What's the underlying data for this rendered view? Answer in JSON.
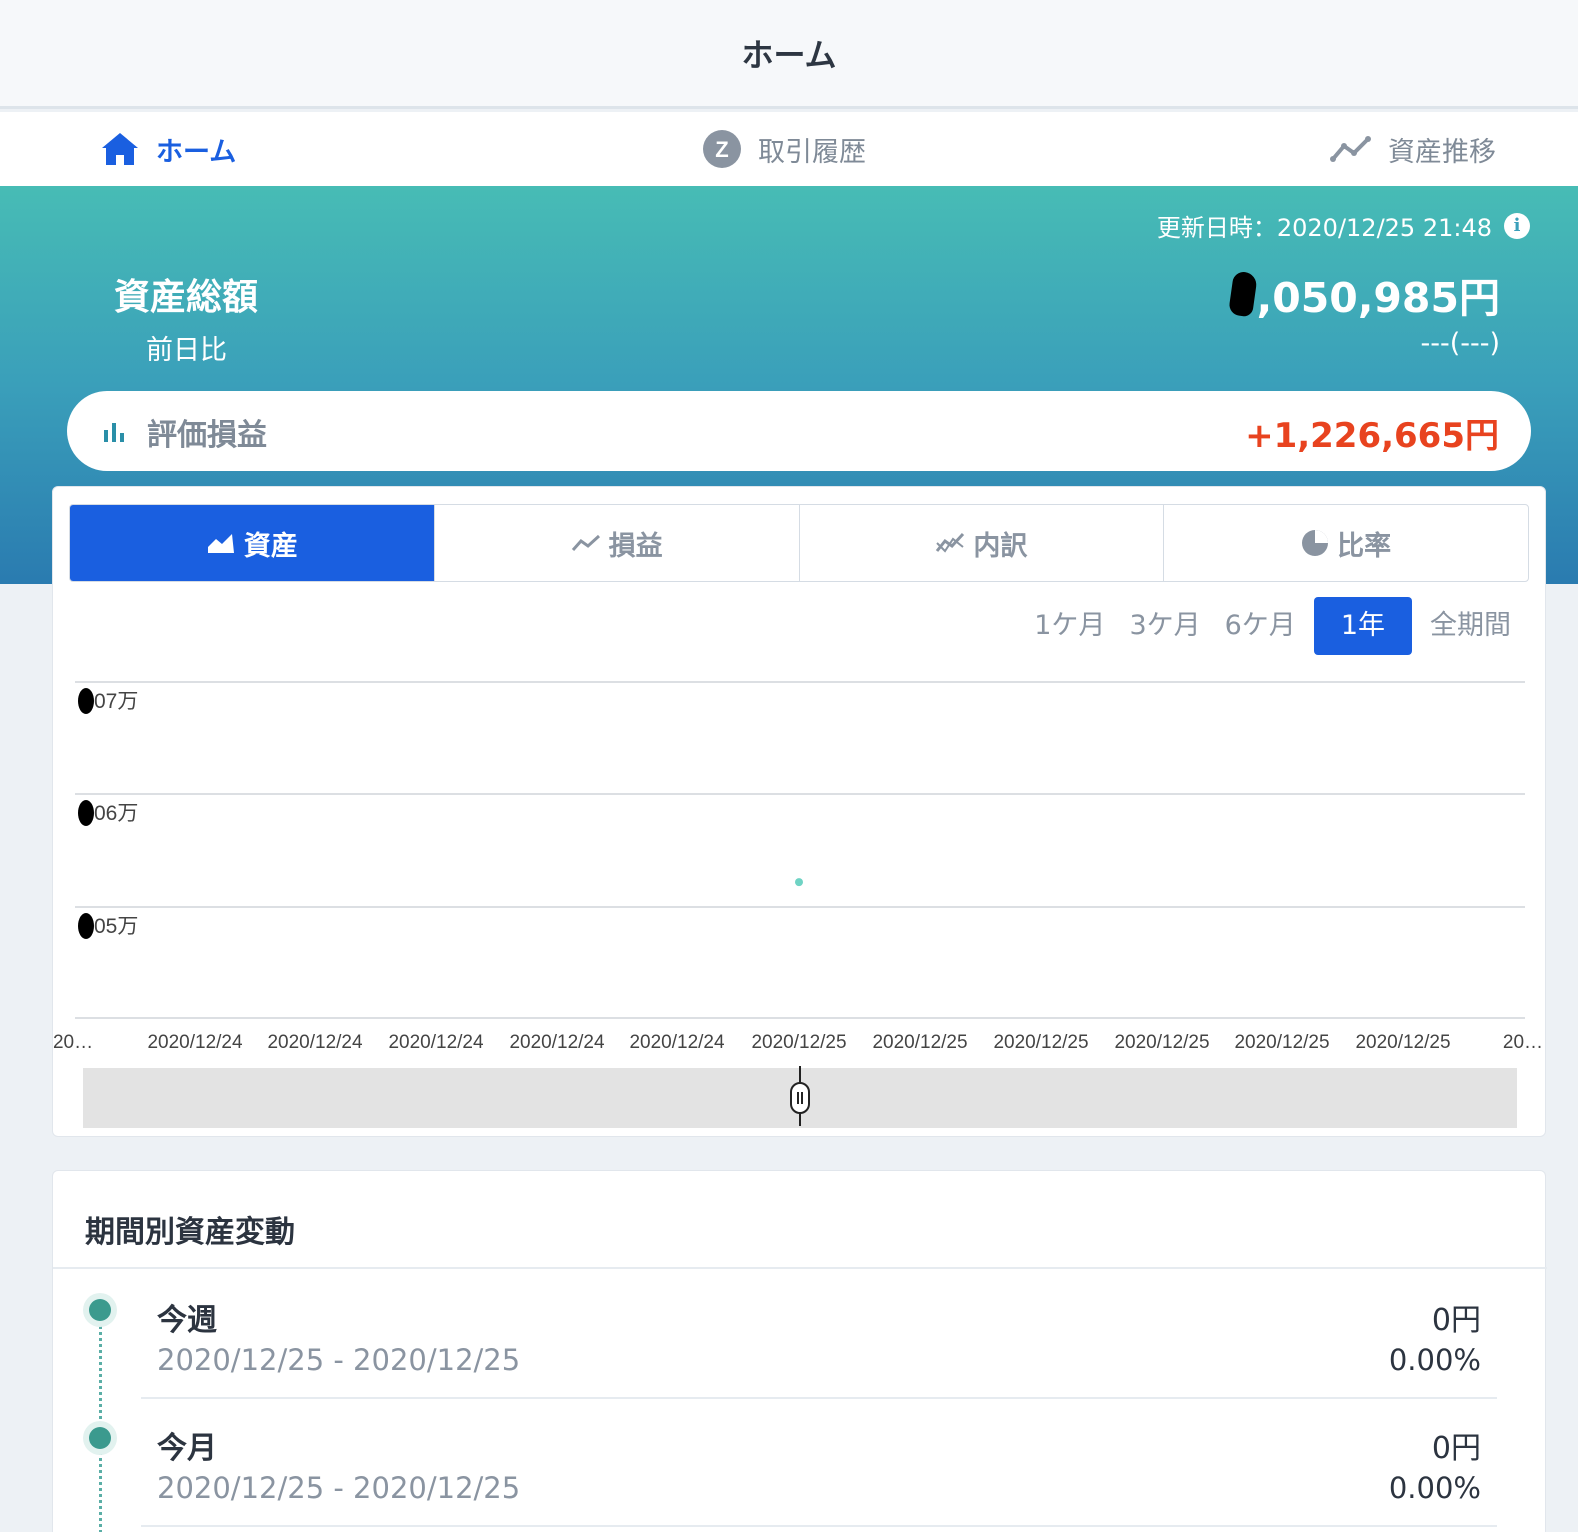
{
  "header": {
    "title": "ホーム"
  },
  "nav": {
    "home": "ホーム",
    "history": "取引履歴",
    "trend": "資産推移"
  },
  "summary": {
    "updated": "更新日時：2020/12/25 21:48",
    "total_label": "資産総額",
    "total_value": ",050,985円",
    "diff_label": "前日比",
    "diff_value": "---(---)"
  },
  "profit": {
    "label": "評価損益",
    "value": "+1,226,665円",
    "value_color": "#e8431f"
  },
  "tabs": [
    "資産",
    "損益",
    "内訳",
    "比率"
  ],
  "periods": [
    "1ケ月",
    "3ケ月",
    "6ケ月",
    "1年",
    "全期間"
  ],
  "active_period": "1年",
  "chart_data": {
    "type": "scatter",
    "y_tick_labels": [
      "07万",
      "06万",
      "05万"
    ],
    "x_tick_labels": [
      "20…",
      "2020/12/24",
      "2020/12/24",
      "2020/12/24",
      "2020/12/24",
      "2020/12/24",
      "2020/12/25",
      "2020/12/25",
      "2020/12/25",
      "2020/12/25",
      "2020/12/25",
      "2020/12/25",
      "20…"
    ],
    "points": [
      {
        "x_index": 6,
        "y_frac_between_06_05": 0.78
      }
    ],
    "point_color": "#6fd3c4",
    "grid": true
  },
  "changes": {
    "title": "期間別資産変動",
    "rows": [
      {
        "label": "今週",
        "range": "2020/12/25 - 2020/12/25",
        "amount": "0円",
        "pct": "0.00%"
      },
      {
        "label": "今月",
        "range": "2020/12/25 - 2020/12/25",
        "amount": "0円",
        "pct": "0.00%"
      }
    ]
  },
  "colors": {
    "accent": "#1a5fe0",
    "loss_gain": "#e8431f",
    "hero_top": "#47bcb5",
    "hero_bottom": "#2a7bb0"
  }
}
